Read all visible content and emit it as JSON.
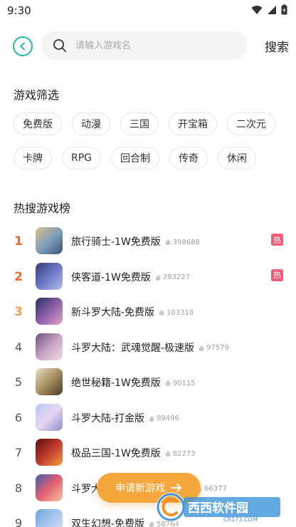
{
  "status": {
    "time": "9:30"
  },
  "search": {
    "placeholder": "请输入游戏名",
    "value": "",
    "button_label": "搜索"
  },
  "filter": {
    "title": "游戏筛选",
    "tags": [
      "免费版",
      "动漫",
      "三国",
      "开宝箱",
      "二次元",
      "卡牌",
      "RPG",
      "回合制",
      "传奇",
      "休闲"
    ]
  },
  "hot": {
    "title": "热搜游戏榜",
    "badge_label": "热",
    "items": [
      {
        "rank": "1",
        "name": "旅行骑士-1W免费版",
        "heat": "398688",
        "hot": true
      },
      {
        "rank": "2",
        "name": "侠客道-1W免费版",
        "heat": "293227",
        "hot": true
      },
      {
        "rank": "3",
        "name": "新斗罗大陆-免费版",
        "heat": "103318",
        "hot": false
      },
      {
        "rank": "4",
        "name": "斗罗大陆：武魂觉醒-极速版",
        "heat": "97579",
        "hot": false
      },
      {
        "rank": "5",
        "name": "绝世秘籍-1W免费版",
        "heat": "90115",
        "hot": false
      },
      {
        "rank": "6",
        "name": "斗罗大陆-打金版",
        "heat": "89496",
        "hot": false
      },
      {
        "rank": "7",
        "name": "极品三国-1W免费版",
        "heat": "82273",
        "hot": false
      },
      {
        "rank": "8",
        "name": "斗罗大",
        "heat": "66377",
        "hot": false
      },
      {
        "rank": "9",
        "name": "双生幻想-免费版",
        "heat": "58764",
        "hot": false
      }
    ]
  },
  "apply_button": {
    "label": "申请新游戏"
  },
  "watermark": {
    "text": "西西软件园",
    "subtext": "CR173.COM"
  },
  "colors": {
    "accent": "#1fb8a8",
    "orange": "#f5a73b",
    "rank_top": "#f06a1c",
    "badge": "#f25a75"
  }
}
